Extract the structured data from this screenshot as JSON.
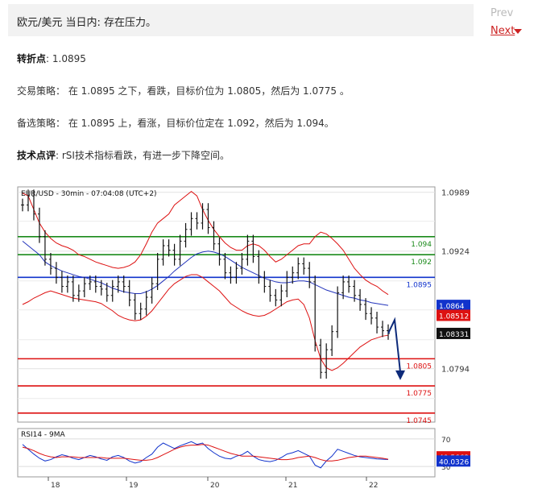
{
  "header": {
    "title": "欧元/美元 当日内: 存在压力。",
    "prev_label": "Prev",
    "next_label": "Next"
  },
  "analysis": {
    "pivot_label": "转折点",
    "pivot_value": ": 1.0895",
    "strategy": "交易策略： 在 1.0895 之下，看跌，目标价位为 1.0805，然后为 1.0775 。",
    "alternative": "备选策略： 在 1.0895 上，看涨，目标价位定在 1.092，然后为 1.094。",
    "comment_label": "技术点评",
    "comment_value": ": rSI技术指标看跌，有进一步下降空间。"
  },
  "chart_data": {
    "type": "line",
    "title": "EUR/USD - 30min - 07:04:08 (UTC+2)",
    "x_ticks": [
      "18",
      "19",
      "20",
      "21",
      "22"
    ],
    "y_ticks": [
      "1.0989",
      "1.0924",
      "1.0794"
    ],
    "levels": [
      {
        "label": "1.094",
        "value": 1.094,
        "color": "#1a8a1a"
      },
      {
        "label": "1.092",
        "value": 1.092,
        "color": "#1a8a1a"
      },
      {
        "label": "1.0895",
        "value": 1.0895,
        "color": "#1133cc"
      },
      {
        "label": "1.0805",
        "value": 1.0805,
        "color": "#dd1111"
      },
      {
        "label": "1.0775",
        "value": 1.0775,
        "color": "#dd1111"
      },
      {
        "label": "1.0745",
        "value": 1.0745,
        "color": "#dd1111"
      }
    ],
    "price_tags": [
      {
        "label": "1.0864",
        "color": "#1133cc"
      },
      {
        "label": "1.08512",
        "color": "#dd1111"
      },
      {
        "label": "1.08331",
        "color": "#111111"
      }
    ],
    "series": [
      {
        "name": "price",
        "color": "#111111",
        "values": [
          1.0975,
          1.0985,
          1.0965,
          1.094,
          1.0915,
          1.0905,
          1.0895,
          1.0885,
          1.089,
          1.0875,
          1.088,
          1.0888,
          1.089,
          1.0885,
          1.0882,
          1.0875,
          1.0885,
          1.089,
          1.0885,
          1.087,
          1.0855,
          1.086,
          1.0873,
          1.0888,
          1.0915,
          1.093,
          1.0925,
          1.0915,
          1.0935,
          1.0948,
          1.096,
          1.0955,
          1.097,
          1.095,
          1.0932,
          1.0915,
          1.09,
          1.0895,
          1.0905,
          1.0915,
          1.0935,
          1.0918,
          1.0895,
          1.0885,
          1.0875,
          1.087,
          1.088,
          1.0895,
          1.09,
          1.091,
          1.0905,
          1.089,
          1.082,
          1.079,
          1.0815,
          1.0835,
          1.0878,
          1.089,
          1.0885,
          1.0875,
          1.0865,
          1.0855,
          1.085,
          1.084,
          1.0836,
          1.0833
        ]
      },
      {
        "name": "ma",
        "color": "#2233bb",
        "values": [
          1.0935,
          1.093,
          1.0925,
          1.092,
          1.0912,
          1.0908,
          1.0905,
          1.0902,
          1.09,
          1.0898,
          1.0896,
          1.0895,
          1.0893,
          1.0891,
          1.0889,
          1.0886,
          1.0883,
          1.0881,
          1.0879,
          1.0878,
          1.0877,
          1.0877,
          1.0879,
          1.0882,
          1.0886,
          1.0891,
          1.0896,
          1.0902,
          1.0907,
          1.0912,
          1.0917,
          1.0921,
          1.0923,
          1.0924,
          1.0923,
          1.0921,
          1.0918,
          1.0914,
          1.091,
          1.0906,
          1.0903,
          1.09,
          1.0897,
          1.0894,
          1.0892,
          1.089,
          1.0889,
          1.0889,
          1.089,
          1.0891,
          1.0891,
          1.089,
          1.0887,
          1.0884,
          1.0881,
          1.0879,
          1.0877,
          1.0875,
          1.0873,
          1.0872,
          1.087,
          1.0869,
          1.0867,
          1.0866,
          1.0865,
          1.0864
        ]
      },
      {
        "name": "bb_upper",
        "color": "#dd1111",
        "values": [
          1.0988,
          1.0985,
          1.097,
          1.0955,
          1.0945,
          1.0938,
          1.0933,
          1.093,
          1.0928,
          1.0925,
          1.092,
          1.0918,
          1.0915,
          1.0912,
          1.091,
          1.0908,
          1.0906,
          1.0905,
          1.0906,
          1.0908,
          1.0912,
          1.092,
          1.0932,
          1.0945,
          1.0955,
          1.096,
          1.0965,
          1.0975,
          1.098,
          1.0985,
          1.099,
          1.0985,
          1.097,
          1.0958,
          1.0948,
          1.094,
          1.0933,
          1.0928,
          1.0925,
          1.0925,
          1.093,
          1.0932,
          1.093,
          1.0925,
          1.0918,
          1.0912,
          1.0915,
          1.092,
          1.0925,
          1.093,
          1.0932,
          1.0932,
          1.094,
          1.0945,
          1.0943,
          1.0938,
          1.0932,
          1.0925,
          1.0915,
          1.0905,
          1.0898,
          1.0892,
          1.0888,
          1.0885,
          1.088,
          1.0876
        ]
      },
      {
        "name": "bb_lower",
        "color": "#dd1111",
        "values": [
          1.0865,
          1.0868,
          1.0872,
          1.0875,
          1.0878,
          1.088,
          1.0878,
          1.0876,
          1.0874,
          1.0872,
          1.0871,
          1.087,
          1.0869,
          1.0868,
          1.0866,
          1.0862,
          1.0858,
          1.0853,
          1.085,
          1.0848,
          1.0847,
          1.0848,
          1.0852,
          1.0858,
          1.0866,
          1.0874,
          1.0882,
          1.0888,
          1.0892,
          1.0896,
          1.0898,
          1.0898,
          1.0895,
          1.089,
          1.0885,
          1.088,
          1.0873,
          1.0866,
          1.0862,
          1.0858,
          1.0855,
          1.0853,
          1.0852,
          1.0853,
          1.0856,
          1.086,
          1.0864,
          1.0868,
          1.087,
          1.0871,
          1.0865,
          1.085,
          1.0825,
          1.0805,
          1.0795,
          1.0792,
          1.0795,
          1.08,
          1.0806,
          1.0812,
          1.0818,
          1.0822,
          1.0826,
          1.0828,
          1.083,
          1.0831
        ]
      }
    ],
    "rsi": {
      "title": "RSI14 - 9MA",
      "y_ticks": [
        "70",
        "30"
      ],
      "tags": [
        {
          "label": "40.5663",
          "color": "#dd1111"
        },
        {
          "label": "40.0326",
          "color": "#1133cc"
        }
      ],
      "rsi_values": [
        62,
        55,
        48,
        42,
        38,
        40,
        44,
        47,
        45,
        42,
        40,
        43,
        46,
        44,
        41,
        39,
        44,
        46,
        43,
        38,
        35,
        37,
        43,
        48,
        58,
        64,
        60,
        56,
        60,
        63,
        66,
        62,
        64,
        56,
        50,
        45,
        42,
        41,
        45,
        47,
        52,
        45,
        40,
        38,
        37,
        39,
        43,
        48,
        50,
        53,
        49,
        45,
        32,
        28,
        38,
        45,
        55,
        52,
        49,
        46,
        44,
        43,
        42,
        41,
        40.5,
        40.03
      ],
      "ma_values": [
        58,
        56,
        53,
        49,
        46,
        44,
        43,
        44,
        44,
        44,
        43,
        43,
        43,
        43,
        43,
        42,
        42,
        42,
        42,
        41,
        40,
        39,
        39,
        40,
        43,
        47,
        51,
        55,
        58,
        60,
        61,
        61,
        62,
        61,
        58,
        55,
        52,
        49,
        47,
        45,
        45,
        45,
        44,
        43,
        42,
        41,
        40,
        40,
        41,
        43,
        44,
        45,
        43,
        40,
        38,
        38,
        39,
        41,
        43,
        44,
        45,
        45,
        44,
        43,
        42,
        40.57
      ]
    }
  }
}
